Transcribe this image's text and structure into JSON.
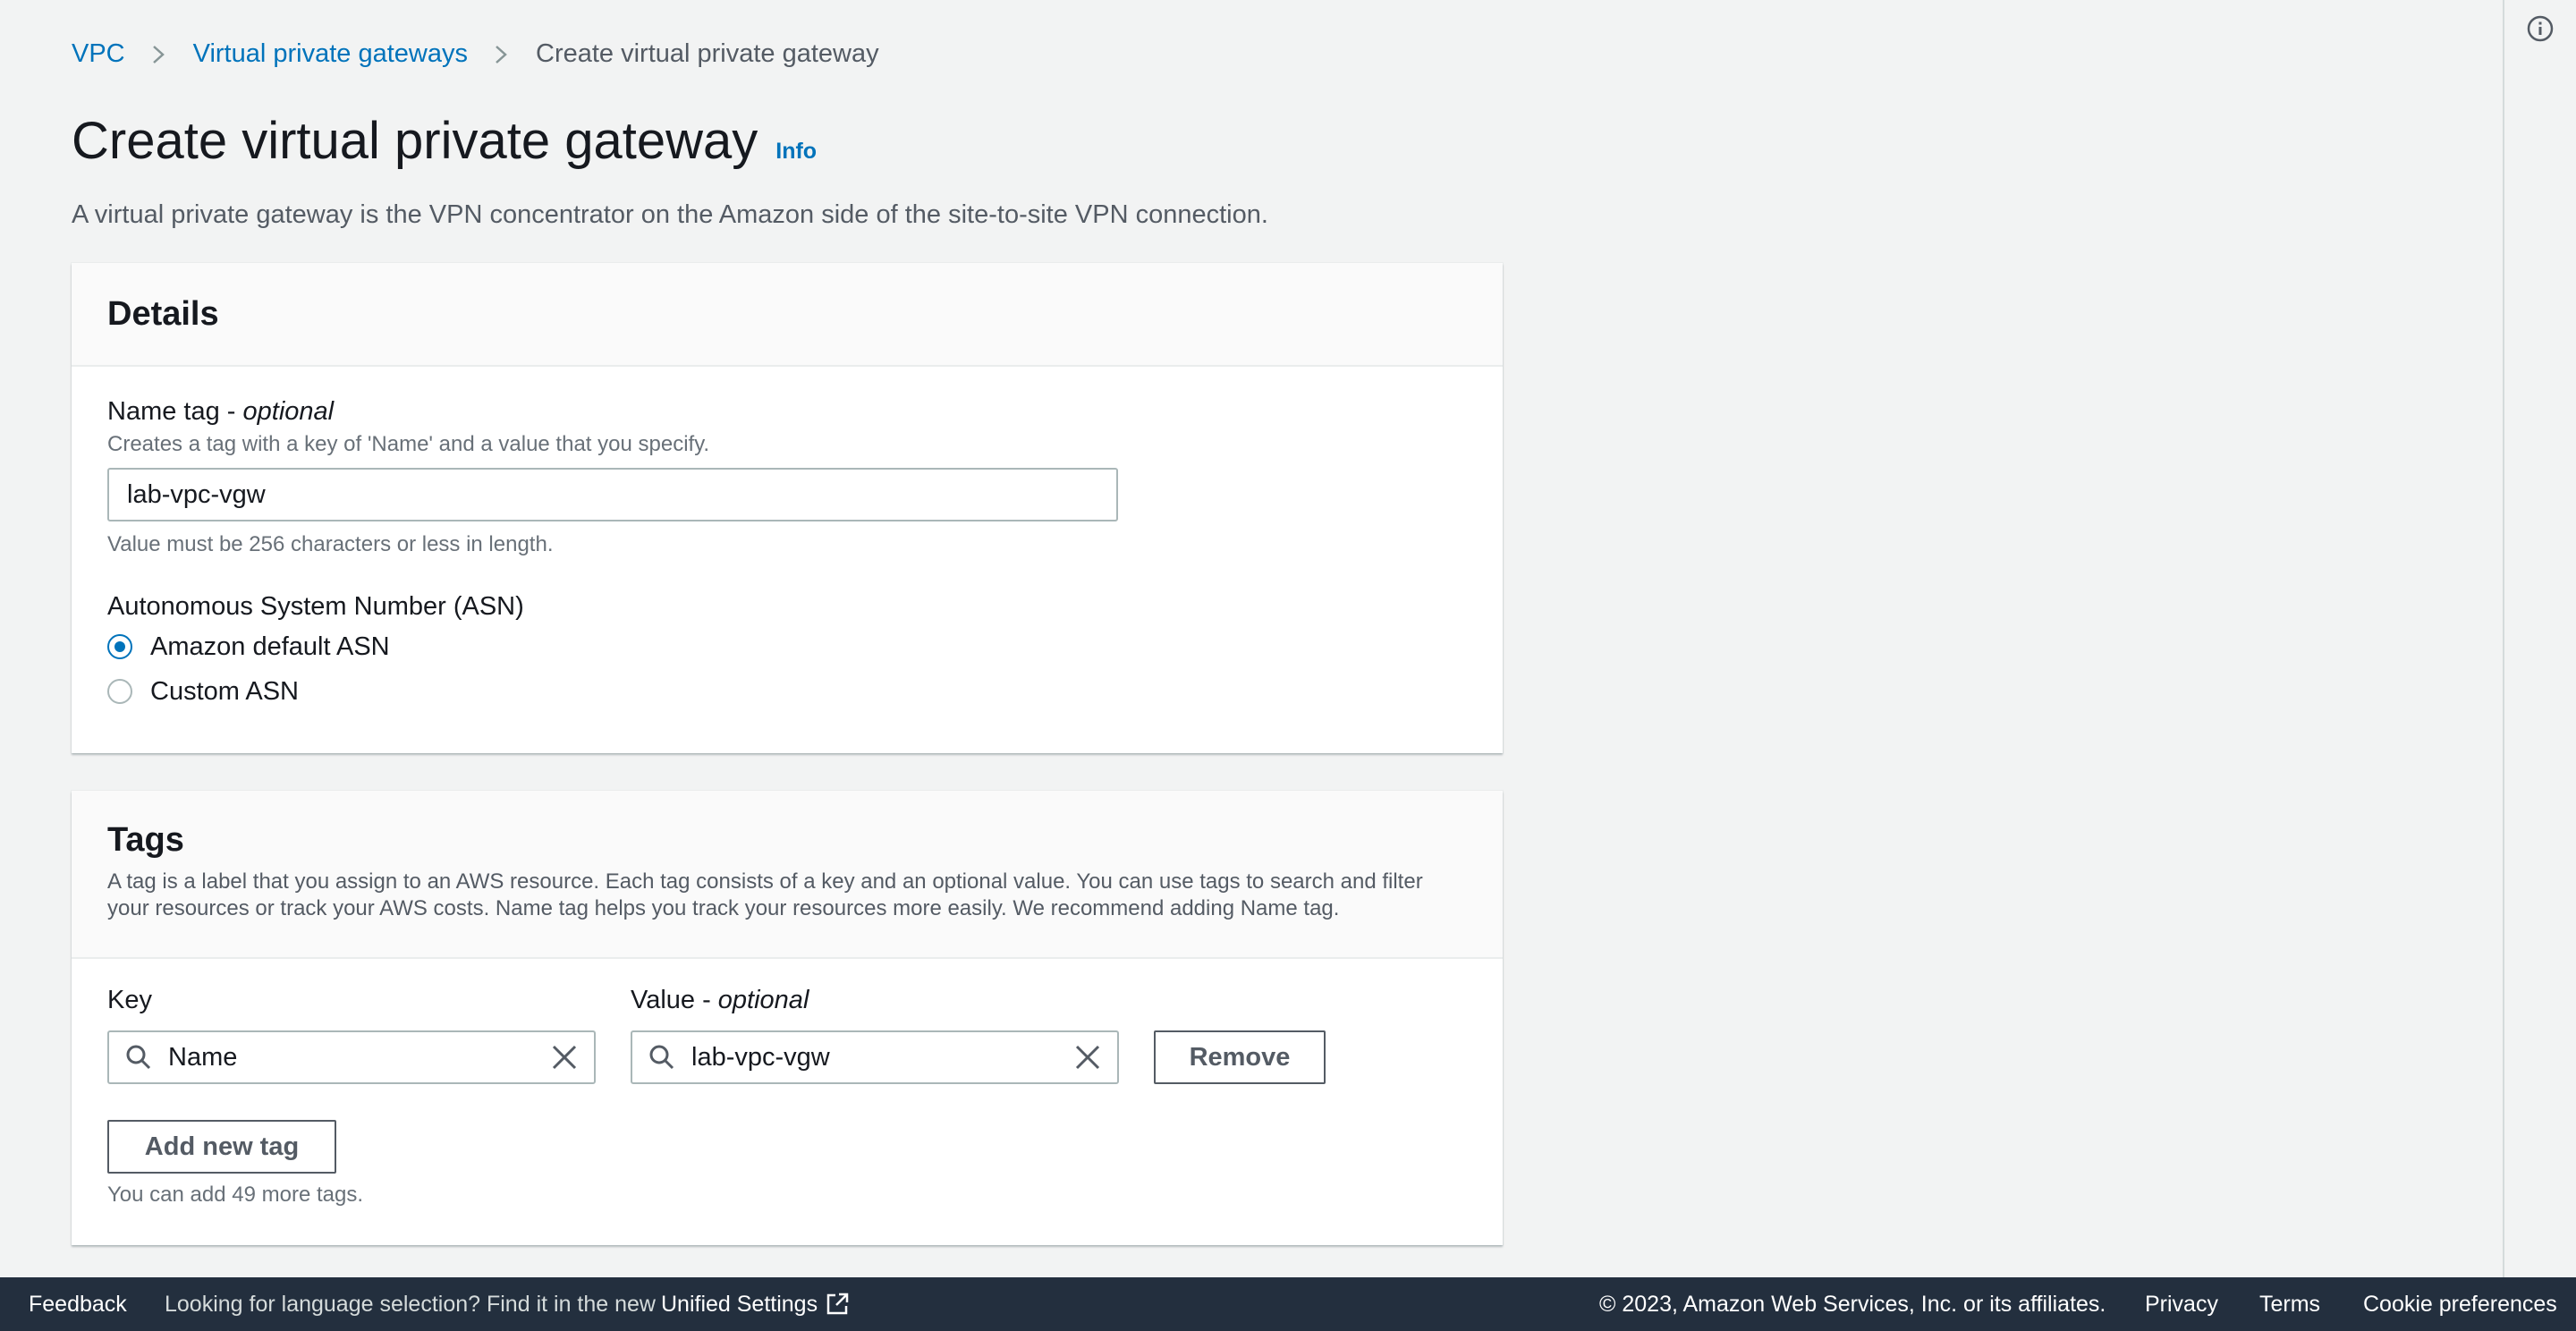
{
  "breadcrumb": {
    "items": [
      "VPC",
      "Virtual private gateways"
    ],
    "current": "Create virtual private gateway"
  },
  "page": {
    "title": "Create virtual private gateway",
    "info": "Info",
    "description": "A virtual private gateway is the VPN concentrator on the Amazon side of the site-to-site VPN connection."
  },
  "details": {
    "title": "Details",
    "name_tag_label": "Name tag - ",
    "name_tag_optional": "optional",
    "name_tag_desc": "Creates a tag with a key of 'Name' and a value that you specify.",
    "name_tag_value": "lab-vpc-vgw",
    "name_tag_constraint": "Value must be 256 characters or less in length.",
    "asn_label": "Autonomous System Number (ASN)",
    "asn_options": [
      {
        "label": "Amazon default ASN",
        "selected": true
      },
      {
        "label": "Custom ASN",
        "selected": false
      }
    ]
  },
  "tags": {
    "title": "Tags",
    "description": "A tag is a label that you assign to an AWS resource. Each tag consists of a key and an optional value. You can use tags to search and filter your resources or track your AWS costs. Name tag helps you track your resources more easily. We recommend adding Name tag.",
    "key_label": "Key",
    "value_label": "Value - ",
    "value_optional": "optional",
    "key_value": "Name",
    "value_value": "lab-vpc-vgw",
    "remove_label": "Remove",
    "add_label": "Add new tag",
    "remaining": "You can add 49 more tags."
  },
  "footer": {
    "feedback": "Feedback",
    "lang_prompt": "Looking for language selection? Find it in the new ",
    "unified_settings": "Unified Settings",
    "copyright": "© 2023, Amazon Web Services, Inc. or its affiliates.",
    "privacy": "Privacy",
    "terms": "Terms",
    "cookies": "Cookie preferences"
  },
  "colors": {
    "link": "#0073bb",
    "footer_bg": "#232f3e",
    "page_bg": "#f2f3f3"
  }
}
